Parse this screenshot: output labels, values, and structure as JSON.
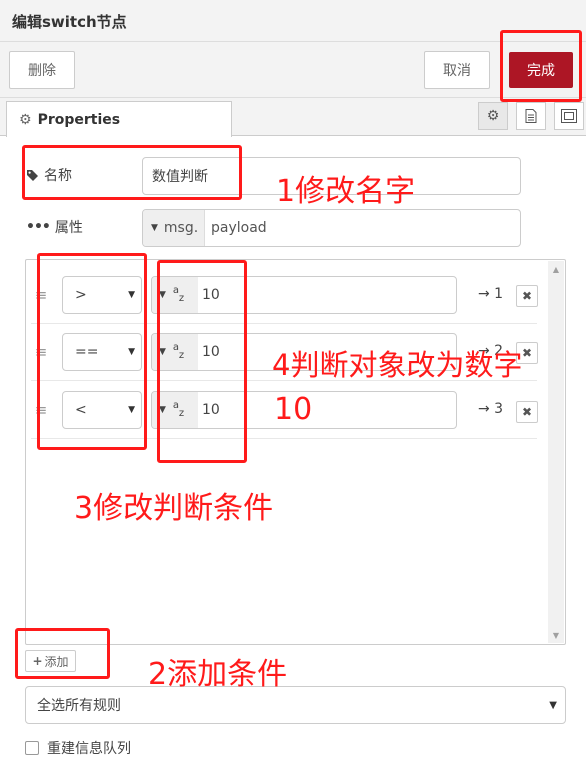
{
  "header": {
    "title": "编辑switch节点"
  },
  "toolbar": {
    "delete_label": "删除",
    "cancel_label": "取消",
    "done_label": "完成"
  },
  "tabs": {
    "properties_label": "Properties",
    "icons": [
      "gear-icon",
      "document-icon",
      "frame-icon"
    ]
  },
  "form": {
    "name_label": "名称",
    "name_value": "数值判断",
    "property_label": "属性",
    "property_type": "msg.",
    "property_value": "payload"
  },
  "rules": [
    {
      "operator": ">",
      "value_type": "string",
      "value": "10",
      "port": "→ 1"
    },
    {
      "operator": "==",
      "value_type": "string",
      "value": "10",
      "port": "→ 2"
    },
    {
      "operator": "<",
      "value_type": "string",
      "value": "10",
      "port": "→ 3"
    }
  ],
  "add_label": "添加",
  "check_all_label": "全选所有规则",
  "recreate_label": "重建信息队列",
  "annotations": {
    "a1": "1修改名字",
    "a2": "2添加条件",
    "a3": "3修改判断条件",
    "a4_line1": "4判断对象改为数字",
    "a4_line2": "10"
  },
  "colors": {
    "primary": "#ad1625",
    "annotation": "#ff1a1a"
  }
}
